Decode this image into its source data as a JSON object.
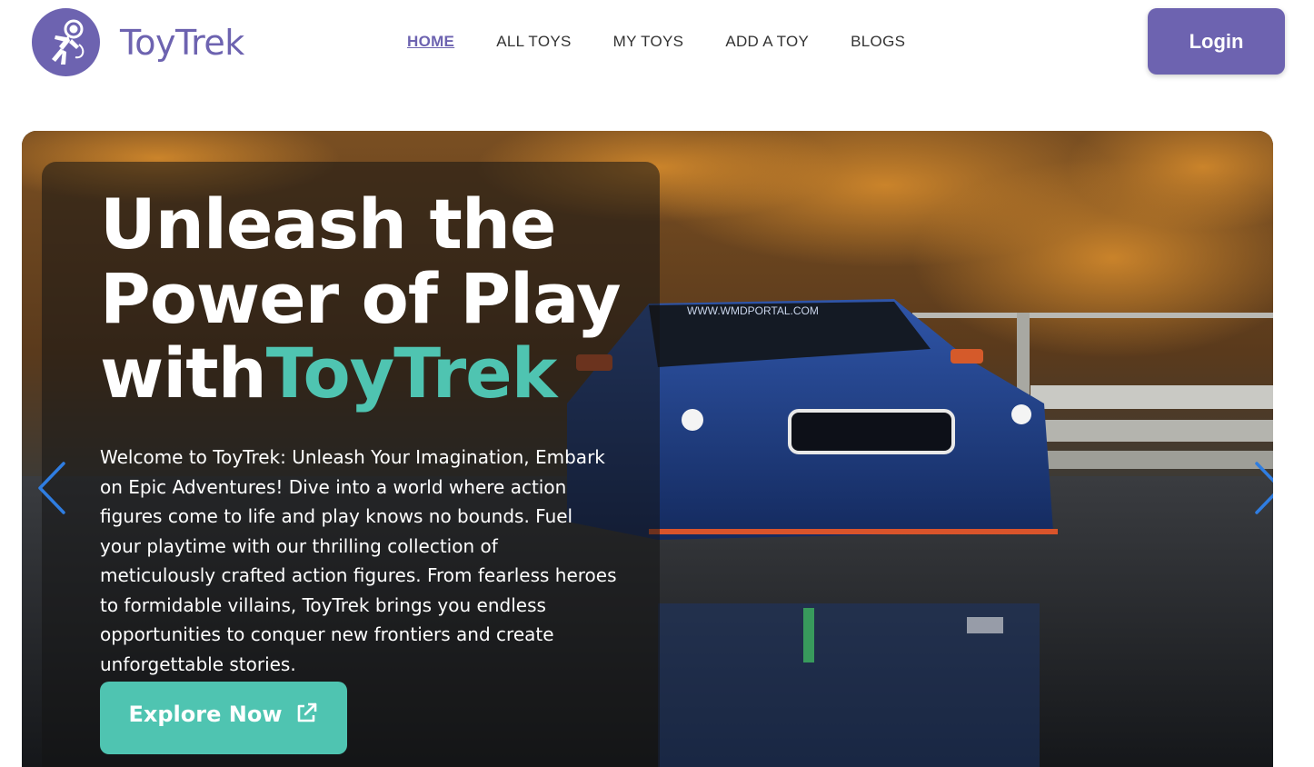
{
  "brand": {
    "name": "ToyTrek",
    "logo_icon": "astronaut-icon"
  },
  "nav": {
    "items": [
      {
        "label": "HOME",
        "active": true
      },
      {
        "label": "ALL TOYS",
        "active": false
      },
      {
        "label": "MY TOYS",
        "active": false
      },
      {
        "label": "ADD A TOY",
        "active": false
      },
      {
        "label": "BLOGS",
        "active": false
      }
    ]
  },
  "header": {
    "login_label": "Login"
  },
  "hero": {
    "headline_line1": "Unleash the",
    "headline_line2": "Power of Play",
    "headline_prefix": "with",
    "headline_accent": "ToyTrek",
    "description": "Welcome to ToyTrek: Unleash Your Imagination, Embark on Epic Adventures! Dive into a world where action figures come to life and play knows no bounds. Fuel your playtime with our thrilling collection of meticulously crafted action figures. From fearless heroes to formidable villains, ToyTrek brings you endless opportunities to conquer new frontiers and create unforgettable stories.",
    "cta_label": "Explore Now",
    "cta_icon": "external-link-icon",
    "car_windshield_text": "WWW.WMDPORTAL.COM",
    "prev_icon": "chevron-left-icon",
    "next_icon": "chevron-right-icon"
  },
  "colors": {
    "brand_purple": "#6d63b0",
    "accent_teal": "#4fc4b1",
    "arrow_blue": "#2f7de1"
  }
}
